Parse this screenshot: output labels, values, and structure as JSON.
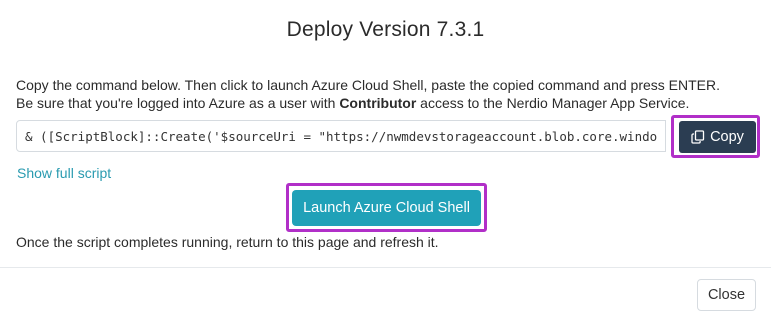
{
  "modal": {
    "title": "Deploy Version 7.3.1"
  },
  "instructions": {
    "line1": "Copy the command below. Then click to launch Azure Cloud Shell, paste the copied command and press ENTER.",
    "line2_prefix": "Be sure that you're logged into Azure as a user with ",
    "line2_bold": "Contributor",
    "line2_suffix": " access to the Nerdio Manager App Service."
  },
  "command": {
    "value": "& ([ScriptBlock]::Create('$sourceUri = \"https://nwmdevstorageaccount.blob.core.windows.net"
  },
  "buttons": {
    "copy_label": "Copy",
    "show_script_label": "Show full script",
    "launch_label": "Launch Azure Cloud Shell",
    "close_label": "Close"
  },
  "note": {
    "after_text": "Once the script completes running, return to this page and refresh it."
  },
  "icons": {
    "copy": "copy-icon"
  },
  "colors": {
    "copy_button_bg": "#2b3d52",
    "launch_button_bg": "#20a1b8",
    "link_color": "#2a9bb0",
    "highlight_border": "#b12fc8"
  }
}
